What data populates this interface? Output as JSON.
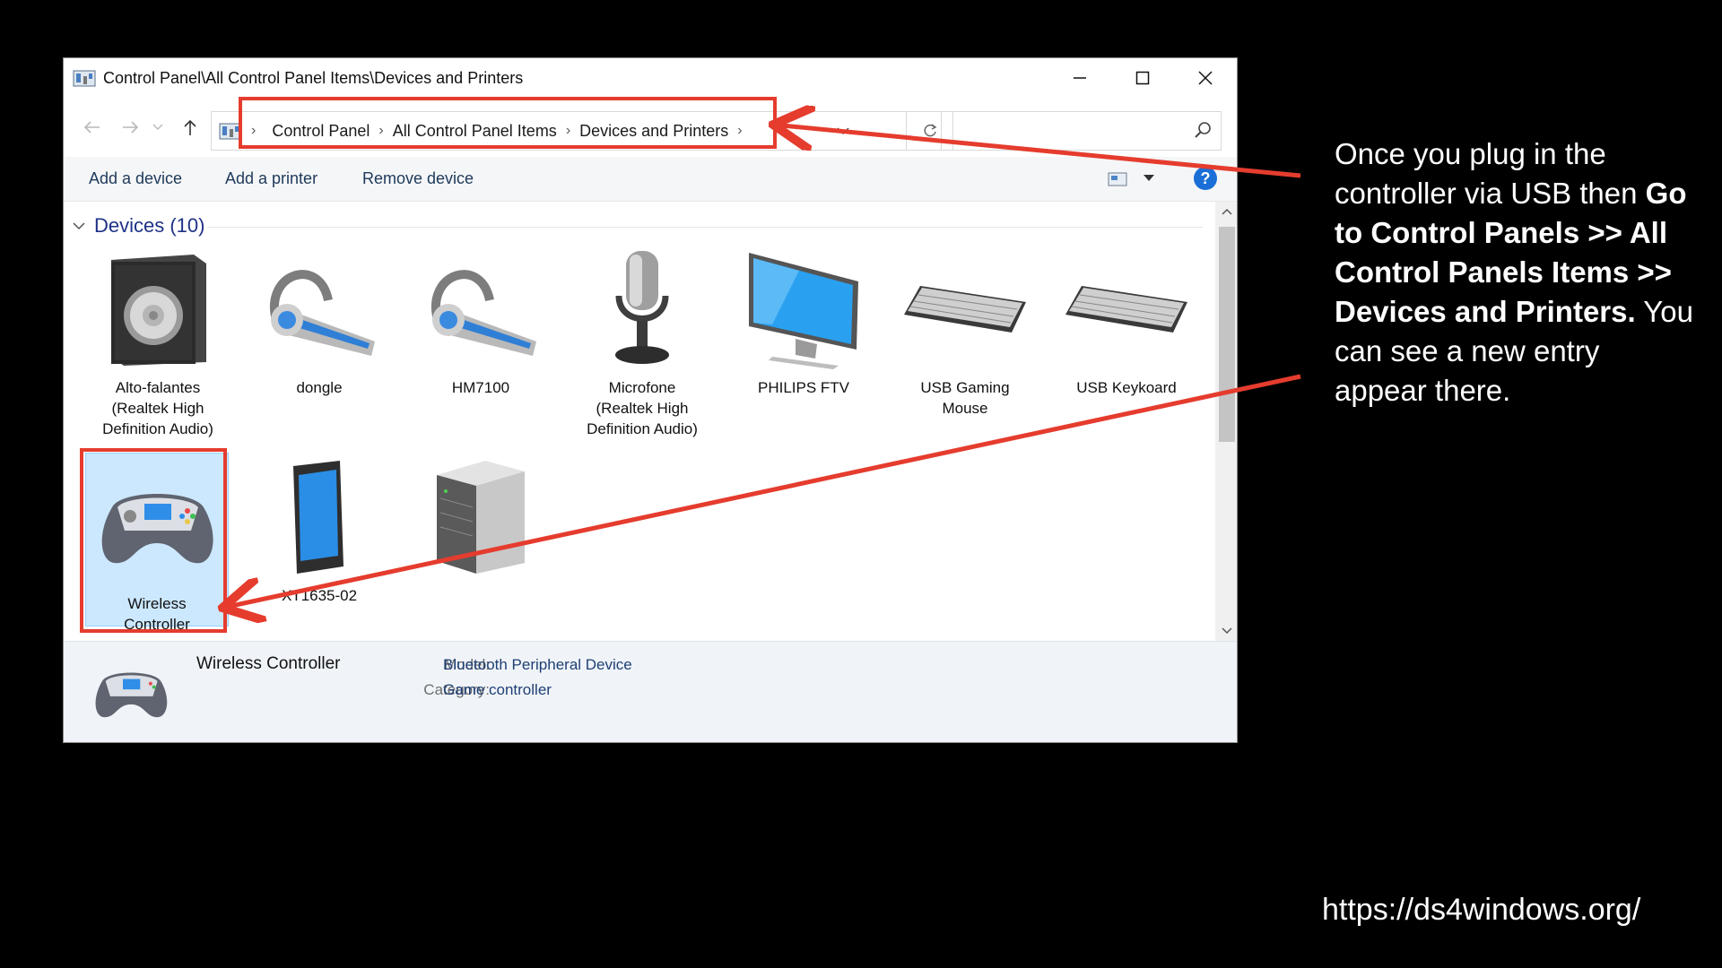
{
  "window": {
    "title": "Control Panel\\All Control Panel Items\\Devices and Printers"
  },
  "address_bar": {
    "crumbs": [
      "Control Panel",
      "All Control Panel Items",
      "Devices and Printers"
    ],
    "search_placeholder": ""
  },
  "toolbar": {
    "add_device": "Add a device",
    "add_printer": "Add a printer",
    "remove_device": "Remove device",
    "help": "?"
  },
  "devices_group": {
    "title": "Devices (10)",
    "items": [
      {
        "label": "Alto-falantes\n(Realtek High\nDefinition Audio)",
        "icon": "speaker-icon"
      },
      {
        "label": "dongle",
        "icon": "headset-icon"
      },
      {
        "label": "HM7100",
        "icon": "headset-icon"
      },
      {
        "label": "Microfone\n(Realtek High\nDefinition Audio)",
        "icon": "microphone-icon"
      },
      {
        "label": "PHILIPS FTV",
        "icon": "monitor-icon"
      },
      {
        "label": "USB Gaming\nMouse",
        "icon": "keyboard-icon"
      },
      {
        "label": "USB Keykoard",
        "icon": "keyboard-icon"
      },
      {
        "label": "Wireless\nController",
        "icon": "gamepad-icon",
        "selected": true
      },
      {
        "label": "XT1635-02",
        "icon": "phone-icon"
      },
      {
        "label": "",
        "icon": "computer-tower-icon"
      }
    ]
  },
  "details_pane": {
    "name": "Wireless Controller",
    "model_key": "Model:",
    "model_value": "Bluetooth Peripheral Device",
    "category_key": "Category:",
    "category_value": "Game controller"
  },
  "annotation": {
    "line1": "Once you plug in the controller via USB then ",
    "bold": "Go to Control Panels >> All Control Panels Items >> Devices and Printers.",
    "line2": " You can see a new entry appear there.",
    "url": "https://ds4windows.org/",
    "accent_color": "#e53c2e"
  }
}
